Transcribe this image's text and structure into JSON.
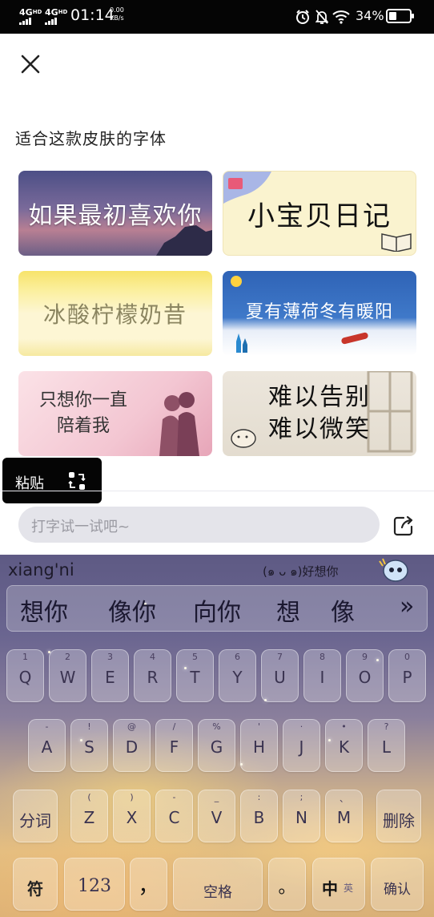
{
  "status_bar": {
    "sim1": "4G",
    "sim1_sup": "HD",
    "sim2": "4G",
    "sim2_sup": "HD",
    "time": "01:14",
    "rate_value": "0.00",
    "rate_unit": "KB/s",
    "battery": "34%"
  },
  "section_title": "适合这款皮肤的字体",
  "font_cards": [
    {
      "text": "如果最初喜欢你",
      "bg": "#5e5a8a"
    },
    {
      "text": "小宝贝日记",
      "bg": "#faf3cf"
    },
    {
      "text": "冰酸柠檬奶昔",
      "bg": "#fcf3c8"
    },
    {
      "text": "夏有薄荷冬有暖阳",
      "bg": "#3a6fbd"
    },
    {
      "text": "只想你一直陪着我",
      "bg": "#f6d6dd"
    },
    {
      "text": "难以告别 难以微笑",
      "bg": "#e7e0d4"
    }
  ],
  "paste_chip": {
    "label": "粘贴"
  },
  "input": {
    "placeholder": "打字试一试吧~"
  },
  "keyboard": {
    "pinyin": "xiang'ni",
    "emoji_phrase": "(๑ ᴗ ๑)好想你",
    "candidates": [
      "想你",
      "像你",
      "向你",
      "想",
      "像"
    ],
    "more": "»",
    "row1": [
      {
        "main": "Q",
        "sub": "1"
      },
      {
        "main": "W",
        "sub": "2"
      },
      {
        "main": "E",
        "sub": "3"
      },
      {
        "main": "R",
        "sub": "4"
      },
      {
        "main": "T",
        "sub": "5"
      },
      {
        "main": "Y",
        "sub": "6"
      },
      {
        "main": "U",
        "sub": "7"
      },
      {
        "main": "I",
        "sub": "8"
      },
      {
        "main": "O",
        "sub": "9"
      },
      {
        "main": "P",
        "sub": "0"
      }
    ],
    "row2": [
      {
        "main": "A",
        "sub": "-"
      },
      {
        "main": "S",
        "sub": "!"
      },
      {
        "main": "D",
        "sub": "@"
      },
      {
        "main": "F",
        "sub": "/"
      },
      {
        "main": "G",
        "sub": "%"
      },
      {
        "main": "H",
        "sub": "'"
      },
      {
        "main": "J",
        "sub": "·"
      },
      {
        "main": "K",
        "sub": "•"
      },
      {
        "main": "L",
        "sub": "?"
      }
    ],
    "row3": [
      {
        "main": "Z",
        "sub": "("
      },
      {
        "main": "X",
        "sub": ")"
      },
      {
        "main": "C",
        "sub": "-"
      },
      {
        "main": "V",
        "sub": "_"
      },
      {
        "main": "B",
        "sub": ":"
      },
      {
        "main": "N",
        "sub": ";"
      },
      {
        "main": "M",
        "sub": "、"
      }
    ],
    "fenci": "分词",
    "delete": "删除",
    "fu": "符",
    "num": "123",
    "comma": "，",
    "space": "空格",
    "period": "。",
    "lang_main": "中",
    "lang_sub": "英",
    "confirm": "确认"
  }
}
